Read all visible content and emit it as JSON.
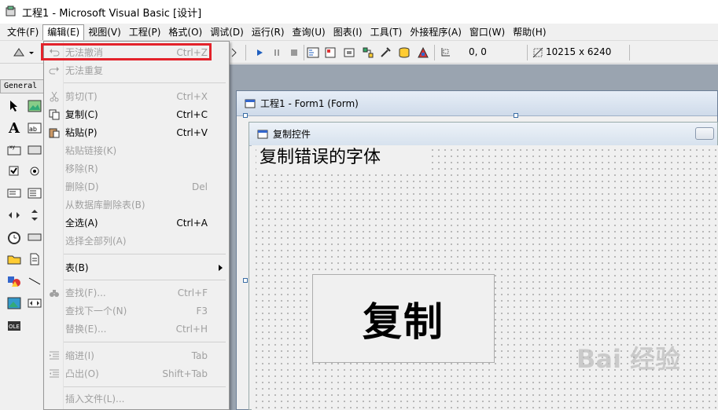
{
  "window": {
    "title": "工程1 - Microsoft Visual Basic [设计]"
  },
  "menubar": {
    "items": [
      "文件(F)",
      "编辑(E)",
      "视图(V)",
      "工程(P)",
      "格式(O)",
      "调试(D)",
      "运行(R)",
      "查询(U)",
      "图表(I)",
      "工具(T)",
      "外接程序(A)",
      "窗口(W)",
      "帮助(H)"
    ],
    "active_index": 1
  },
  "toolbar": {
    "position_readout": "0, 0",
    "size_readout": "10215 x 6240"
  },
  "toolbox": {
    "header": "General"
  },
  "edit_menu": {
    "items": [
      {
        "icon": "undo-icon",
        "label": "无法撤消",
        "shortcut": "Ctrl+Z",
        "disabled": true
      },
      {
        "icon": "redo-icon",
        "label": "无法重复",
        "shortcut": "",
        "disabled": true
      },
      {
        "icon": "cut-icon",
        "label": "剪切(T)",
        "shortcut": "Ctrl+X",
        "disabled": true
      },
      {
        "icon": "copy-icon",
        "label": "复制(C)",
        "shortcut": "Ctrl+C",
        "disabled": false
      },
      {
        "icon": "paste-icon",
        "label": "粘贴(P)",
        "shortcut": "Ctrl+V",
        "disabled": false
      },
      {
        "icon": "",
        "label": "粘贴链接(K)",
        "shortcut": "",
        "disabled": true
      },
      {
        "icon": "",
        "label": "移除(R)",
        "shortcut": "",
        "disabled": true
      },
      {
        "icon": "",
        "label": "删除(D)",
        "shortcut": "Del",
        "disabled": true
      },
      {
        "icon": "",
        "label": "从数据库删除表(B)",
        "shortcut": "",
        "disabled": true
      },
      {
        "icon": "",
        "label": "全选(A)",
        "shortcut": "Ctrl+A",
        "disabled": false
      },
      {
        "icon": "",
        "label": "选择全部列(A)",
        "shortcut": "",
        "disabled": true
      },
      {
        "icon": "",
        "label": "表(B)",
        "shortcut": "",
        "disabled": false
      },
      {
        "icon": "find-icon",
        "label": "查找(F)...",
        "shortcut": "Ctrl+F",
        "disabled": true
      },
      {
        "icon": "",
        "label": "查找下一个(N)",
        "shortcut": "F3",
        "disabled": true
      },
      {
        "icon": "",
        "label": "替换(E)...",
        "shortcut": "Ctrl+H",
        "disabled": true
      },
      {
        "icon": "indent-icon",
        "label": "缩进(I)",
        "shortcut": "Tab",
        "disabled": true
      },
      {
        "icon": "outdent-icon",
        "label": "凸出(O)",
        "shortcut": "Shift+Tab",
        "disabled": true
      },
      {
        "icon": "",
        "label": "插入文件(L)...",
        "shortcut": "",
        "disabled": true
      }
    ]
  },
  "designer": {
    "outer_title": "工程1 - Form1 (Form)",
    "inner_title": "复制控件",
    "label_text": "复制错误的字体",
    "button_text": "复制"
  },
  "watermark": {
    "text": "Bai 经验"
  },
  "colors": {
    "highlight": "#e3222b",
    "disabled": "#a0a0a0"
  }
}
